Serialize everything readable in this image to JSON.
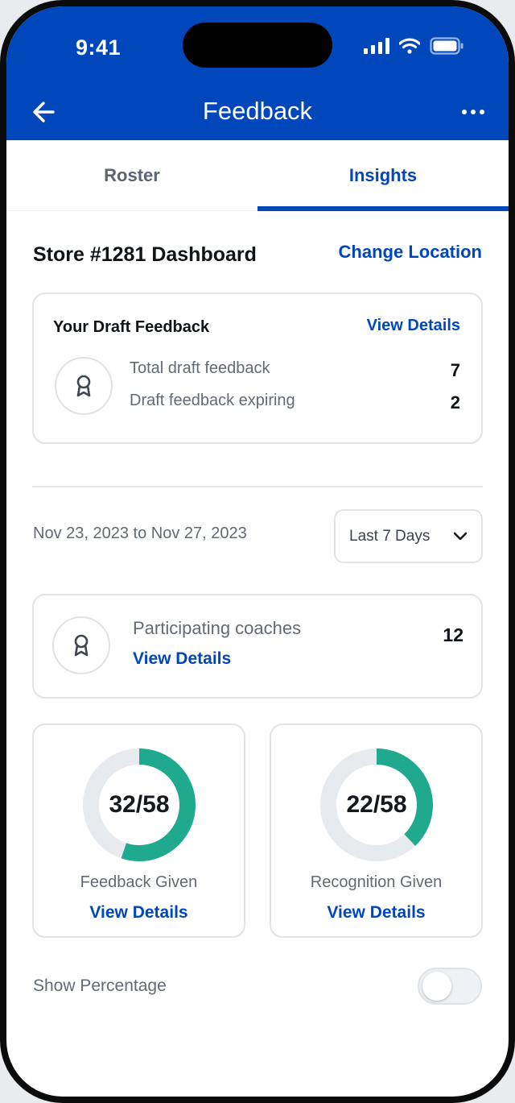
{
  "status_bar": {
    "time": "9:41"
  },
  "header": {
    "title": "Feedback"
  },
  "tabs": [
    {
      "label": "Roster",
      "active": false
    },
    {
      "label": "Insights",
      "active": true
    }
  ],
  "dashboard": {
    "title": "Store #1281 Dashboard",
    "change_location_label": "Change Location"
  },
  "draft_card": {
    "title": "Your Draft Feedback",
    "view_details_label": "View Details",
    "rows": [
      {
        "label": "Total draft feedback",
        "value": "7"
      },
      {
        "label": "Draft feedback expiring",
        "value": "2"
      }
    ]
  },
  "date_filter": {
    "range_text": "Nov 23, 2023 to Nov 27, 2023",
    "selected": "Last 7 Days"
  },
  "coaches_card": {
    "label": "Participating coaches",
    "view_details_label": "View Details",
    "value": "12"
  },
  "stats": [
    {
      "value_text": "32/58",
      "numerator": 32,
      "denominator": 58,
      "label": "Feedback Given",
      "view_details_label": "View Details"
    },
    {
      "value_text": "22/58",
      "numerator": 22,
      "denominator": 58,
      "label": "Recognition Given",
      "view_details_label": "View Details"
    }
  ],
  "donut_colors": {
    "fill": "#1fa98d",
    "track": "#e7ebef"
  },
  "show_percentage": {
    "label": "Show Percentage",
    "enabled": false
  },
  "colors": {
    "brand": "#0047bb",
    "accent": "#1fa98d"
  }
}
